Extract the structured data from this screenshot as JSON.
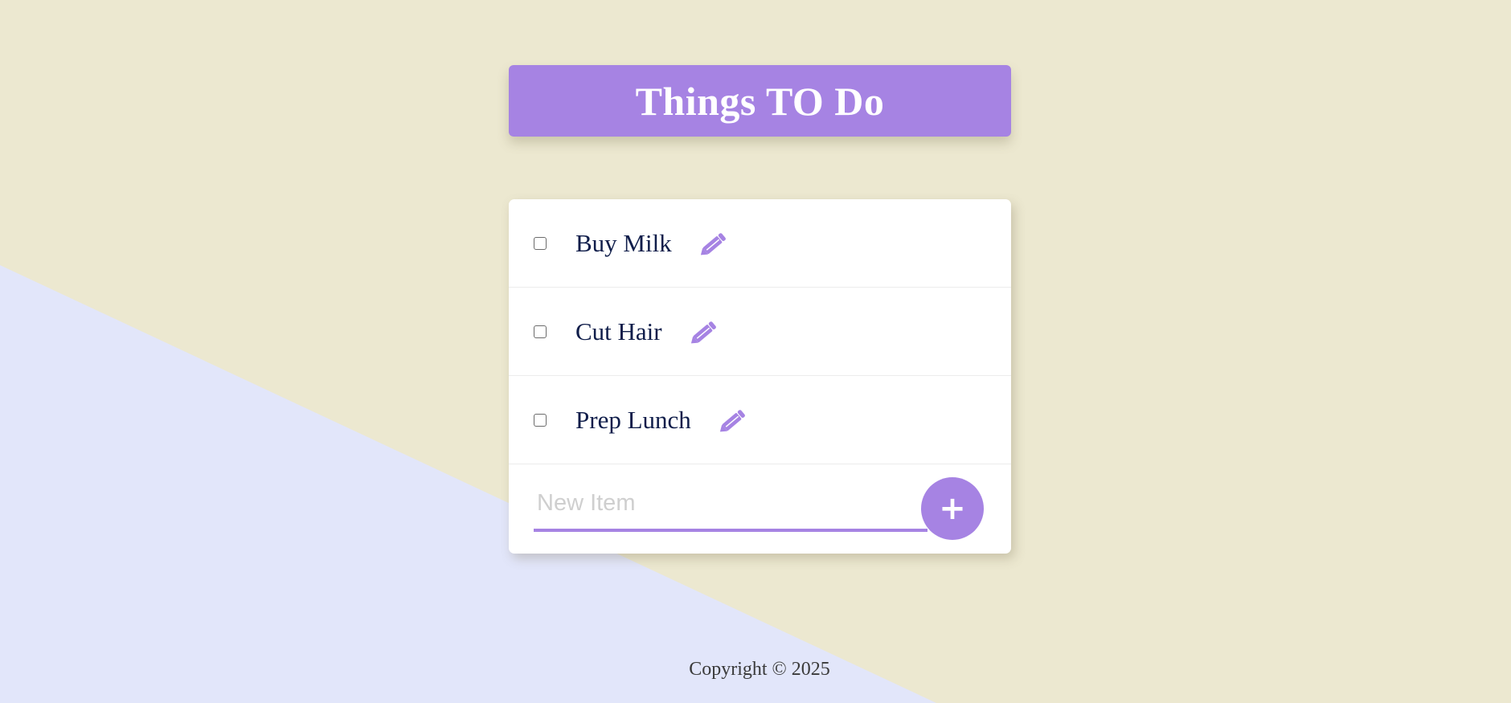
{
  "colors": {
    "background": "#ece8d0",
    "background_shape": "#e2e6fa",
    "accent": "#a683e3",
    "item_text": "#0f1d4a"
  },
  "header": {
    "title": "Things TO Do"
  },
  "items": [
    {
      "label": "Buy Milk",
      "checked": false,
      "edit_icon": "pencil-icon"
    },
    {
      "label": "Cut Hair",
      "checked": false,
      "edit_icon": "pencil-icon"
    },
    {
      "label": "Prep Lunch",
      "checked": false,
      "edit_icon": "pencil-icon"
    }
  ],
  "new_item": {
    "value": "",
    "placeholder": "New Item",
    "add_label": "+"
  },
  "footer": {
    "copyright": "Copyright © 2025"
  }
}
